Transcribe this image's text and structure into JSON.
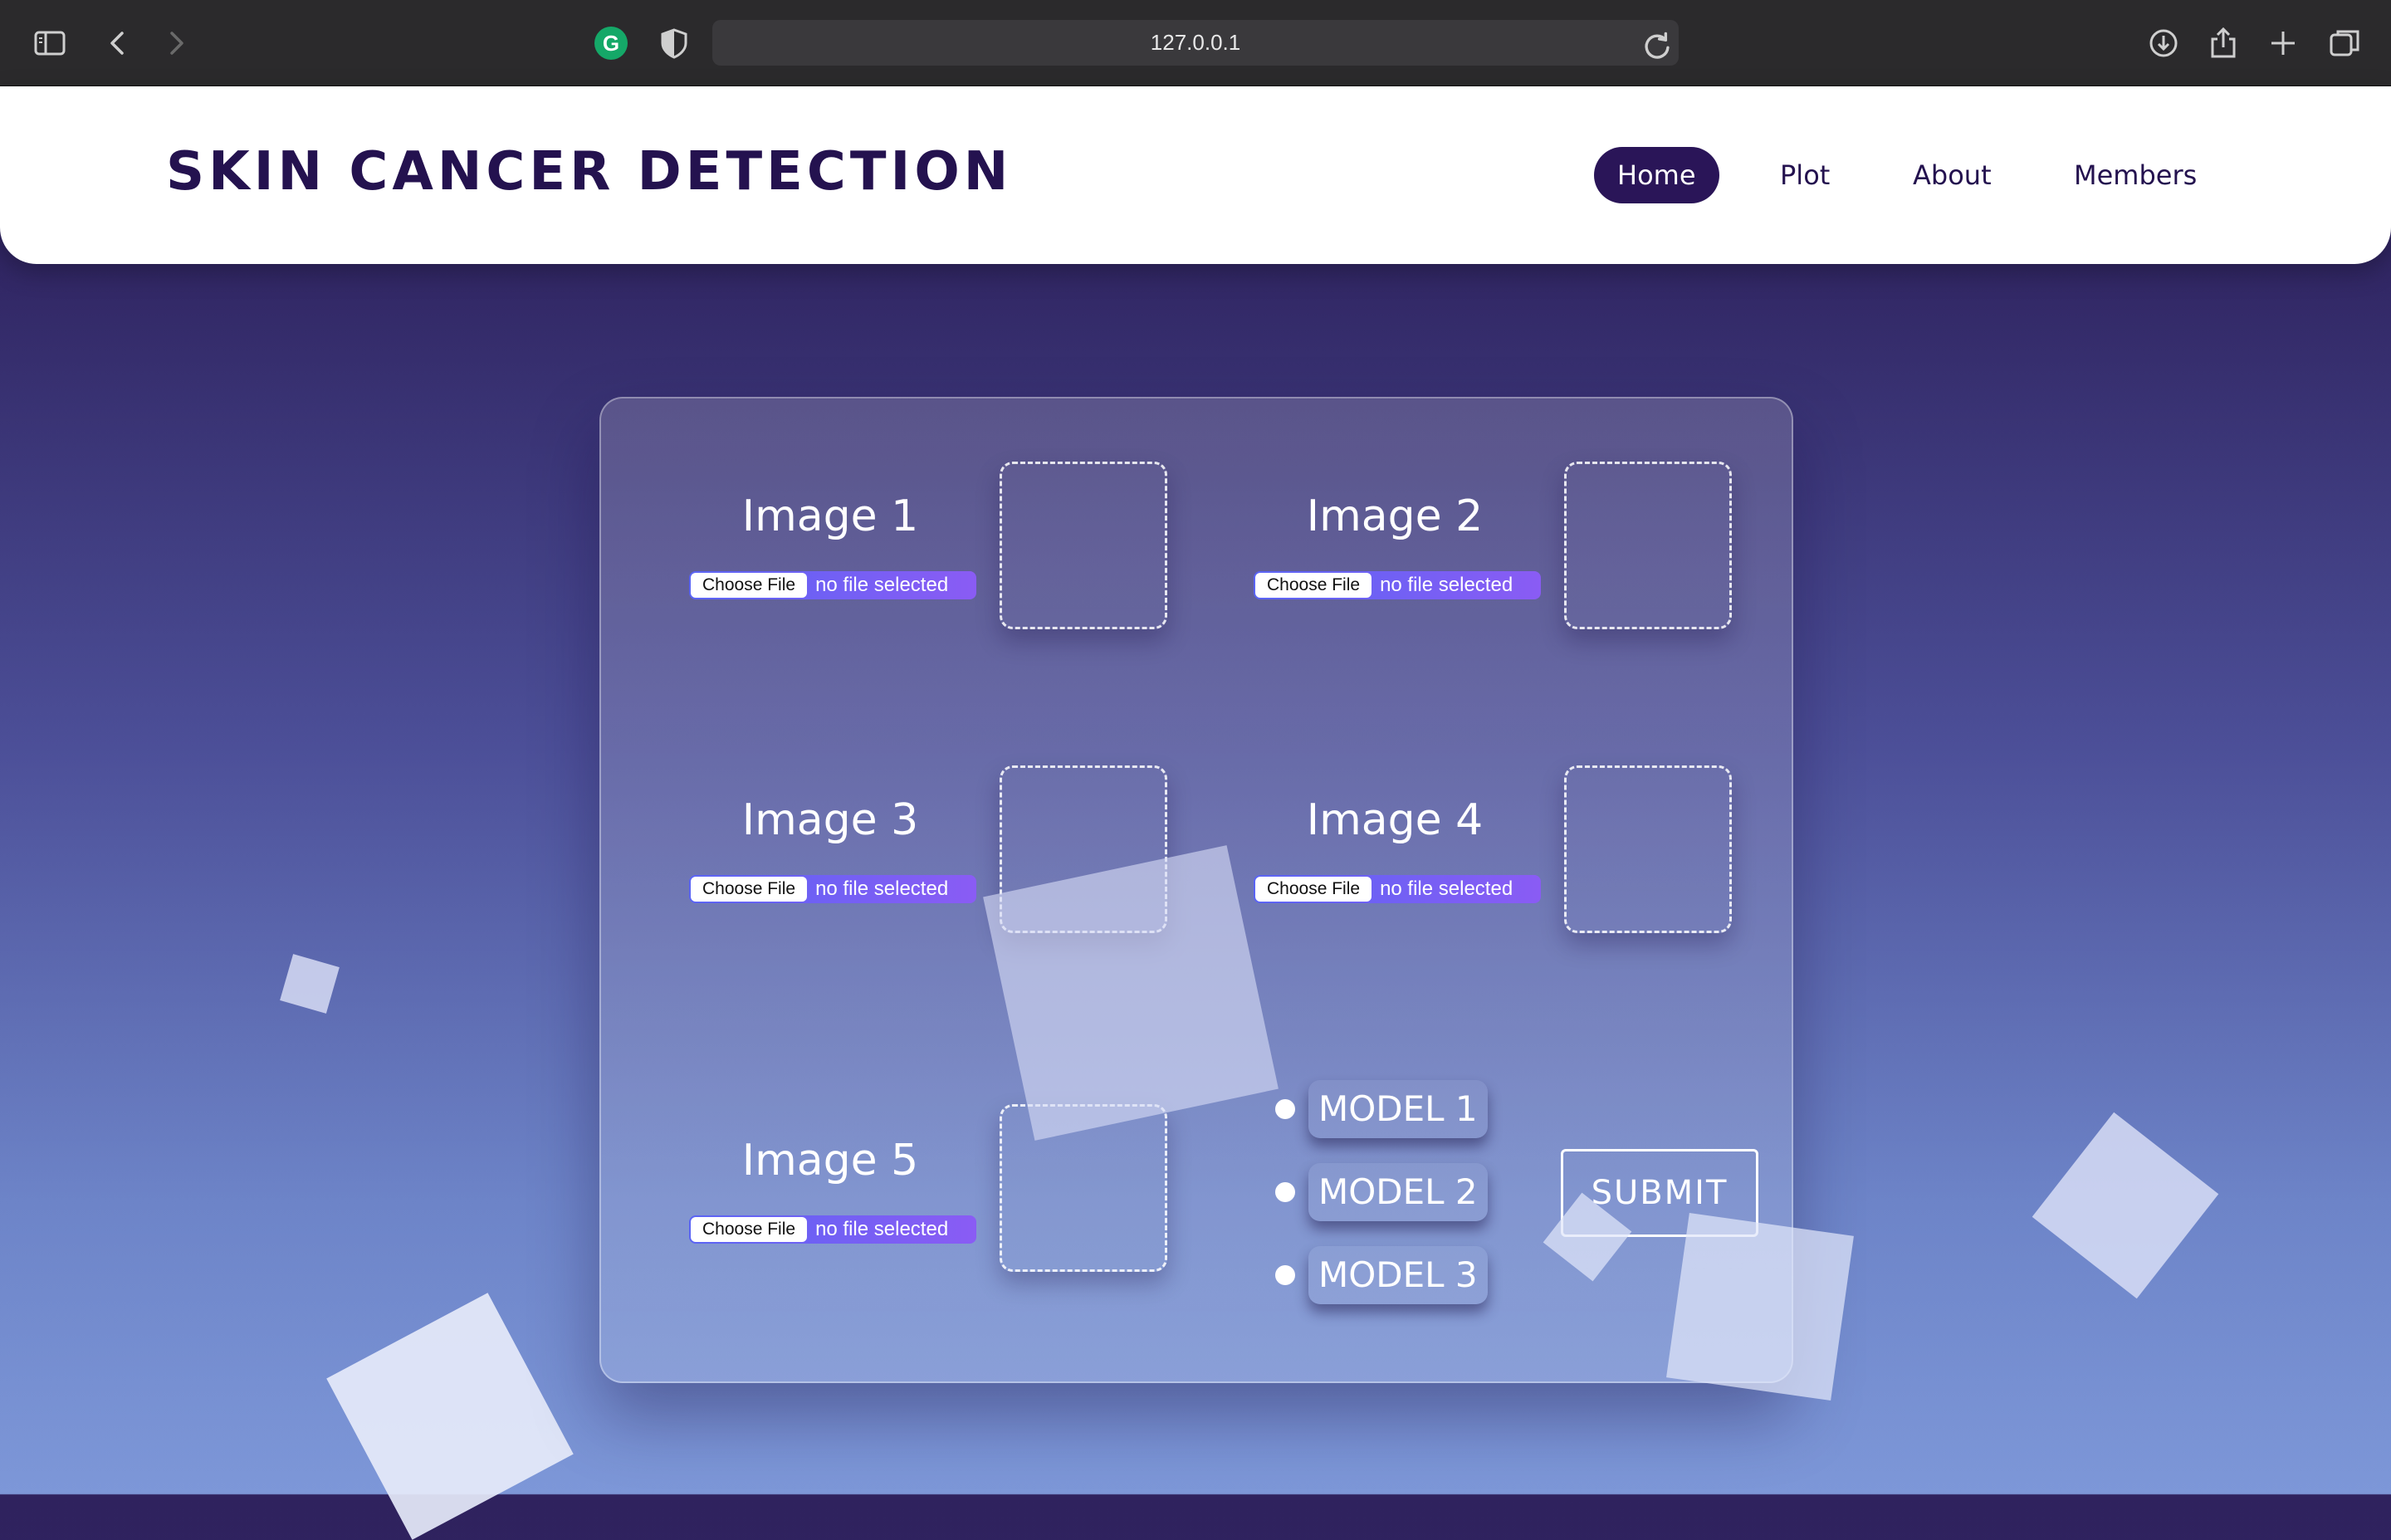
{
  "browser": {
    "url": "127.0.0.1",
    "icons": [
      "sidebar-icon",
      "back-icon",
      "forward-icon",
      "grammarly-icon",
      "shield-icon",
      "reload-icon",
      "download-icon",
      "share-icon",
      "new-tab-icon",
      "tabs-overview-icon"
    ],
    "grammarly_letter": "G"
  },
  "header": {
    "brand": "SKIN CANCER DETECTION",
    "nav": [
      "Home",
      "Plot",
      "About",
      "Members"
    ],
    "active": "Home"
  },
  "uploads": [
    {
      "title": "Image 1",
      "choose_label": "Choose File",
      "status": "no file selected"
    },
    {
      "title": "Image 2",
      "choose_label": "Choose File",
      "status": "no file selected"
    },
    {
      "title": "Image 3",
      "choose_label": "Choose File",
      "status": "no file selected"
    },
    {
      "title": "Image 4",
      "choose_label": "Choose File",
      "status": "no file selected"
    },
    {
      "title": "Image 5",
      "choose_label": "Choose File",
      "status": "no file selected"
    }
  ],
  "models": [
    "MODEL 1",
    "MODEL 2",
    "MODEL 3"
  ],
  "submit_label": "SUBMIT",
  "colors": {
    "brand": "#24124f",
    "nav_active_bg": "#2a1558",
    "file_status_gradient": [
      "#5a64f4",
      "#8a5cf4"
    ]
  }
}
